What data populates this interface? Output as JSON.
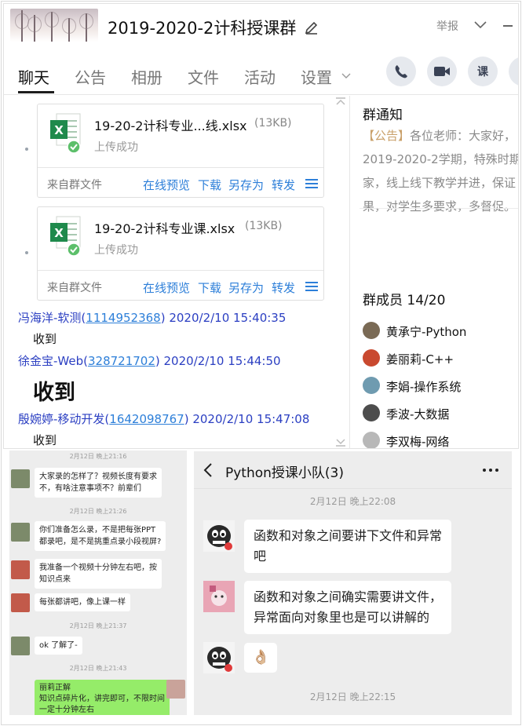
{
  "window": {
    "title": "2019-2020-2计科授课群",
    "report_label": "举报"
  },
  "tabs": [
    {
      "label": "聊天",
      "active": true
    },
    {
      "label": "公告"
    },
    {
      "label": "相册"
    },
    {
      "label": "文件"
    },
    {
      "label": "活动"
    },
    {
      "label": "设置"
    }
  ],
  "action_buttons": {
    "lesson_label": "课"
  },
  "files": [
    {
      "name": "19-20-2计科专业...线.xlsx",
      "size": "(13KB)",
      "status": "上传成功",
      "source": "来自群文件",
      "actions": [
        "在线预览",
        "下载",
        "另存为",
        "转发"
      ]
    },
    {
      "name": "19-20-2计科专业课.xlsx",
      "size": "(13KB)",
      "status": "上传成功",
      "source": "来自群文件",
      "actions": [
        "在线预览",
        "下载",
        "另存为",
        "转发"
      ]
    }
  ],
  "messages": [
    {
      "sender": "冯海洋-软测",
      "sender_id": "1114952368",
      "time": "2020/2/10 15:40:35",
      "text": "收到"
    },
    {
      "sender": "徐金宝-Web",
      "sender_id": "328721702",
      "time": "2020/2/10 15:44:50",
      "text": "收到"
    },
    {
      "sender": "殷婉婷-移动开发",
      "sender_id": "1642098767",
      "time": "2020/2/10 15:47:08",
      "text": "收到"
    }
  ],
  "notice": {
    "title": "群通知",
    "tag": "【公告】",
    "lines": [
      "各位老师：大家好，",
      "2019-2020-2学期，特殊时期",
      "家，线上线下教学并进，保证",
      "果，对学生多要求，多督促。"
    ]
  },
  "members": {
    "title": "群成员 14/20",
    "list": [
      {
        "name": "黄承宁-Python",
        "color": "#7a6a55"
      },
      {
        "name": "姜丽莉-C++",
        "color": "#c9492f"
      },
      {
        "name": "李娟-操作系统",
        "color": "#6f9bb0"
      },
      {
        "name": "季波-大数据",
        "color": "#4d4d4d"
      },
      {
        "name": "李双梅-网络",
        "color": "#b8b8b8"
      }
    ]
  },
  "mini_chat": {
    "items": [
      {
        "time": "2月12日 晚上21:16"
      },
      {
        "text_lines": [
          "大家录的怎样了？视频长度有要求",
          "不，有啥注意事项不？前辈们"
        ]
      },
      {
        "time": "2月12日 晚上21:26"
      },
      {
        "text_lines": [
          "你们准备怎么录，不是把每张PPT",
          "都录吧，是不是挑重点录小段视屏?"
        ]
      },
      {
        "text_lines": [
          "我准备一个视频十分钟左右吧，按",
          "知识点来"
        ]
      },
      {
        "text_lines": [
          "每张都讲吧，像上课一样"
        ]
      },
      {
        "time": "2月12日 晚上21:37"
      },
      {
        "text_lines": [
          "ok 了解了-"
        ]
      },
      {
        "time": "2月12日 晚上21:43"
      },
      {
        "text_lines": [
          "丽莉正解",
          "知识点碎片化，讲完即可，不限时间",
          "一定十分钟左右"
        ]
      }
    ]
  },
  "py_chat": {
    "title": "Python授课小队(3)",
    "time1": "2月12日 晚上22:08",
    "bubble1_lines": [
      "函数和对象之间要讲下文件和异常",
      "吧"
    ],
    "bubble2_lines": [
      "函数和对象之间确实需要讲文件，",
      "异常面向对象里也是可以讲解的"
    ],
    "bubble3_emoji": "👌🏼",
    "time2": "2月12日 晚上22:15"
  }
}
